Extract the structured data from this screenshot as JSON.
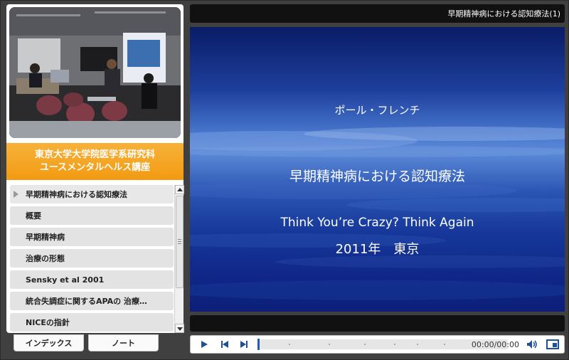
{
  "sidebar": {
    "banner": {
      "line1": "東京大学大学院医学系研究科",
      "line2": "ユースメンタルヘルス講座"
    },
    "items": [
      {
        "label": "早期精神病における認知療法",
        "active": true
      },
      {
        "label": "概要"
      },
      {
        "label": "早期精神病"
      },
      {
        "label": "治療の形態"
      },
      {
        "label": "Sensky et al 2001"
      },
      {
        "label": "統合失調症に関するAPAの 治療…"
      },
      {
        "label": "NICEの指針"
      }
    ],
    "tabs": {
      "index": "インデックス",
      "note": "ノート"
    }
  },
  "header": {
    "title": "早期精神病における認知療法(1)"
  },
  "slide": {
    "author": "ポール・フレンチ",
    "title": "早期精神病における認知療法",
    "subtitle": "Think You’re Crazy? Think Again",
    "year": "2011年　東京"
  },
  "player": {
    "time": "00:00/00:00",
    "progress": 0,
    "icons": [
      "play-icon",
      "previous-icon",
      "next-icon",
      "volume-icon",
      "layout-icon"
    ]
  },
  "colors": {
    "accent_orange": "#f29a12",
    "seek_head": "#2a5ea8",
    "slide_blue": "#1d3f9c"
  }
}
